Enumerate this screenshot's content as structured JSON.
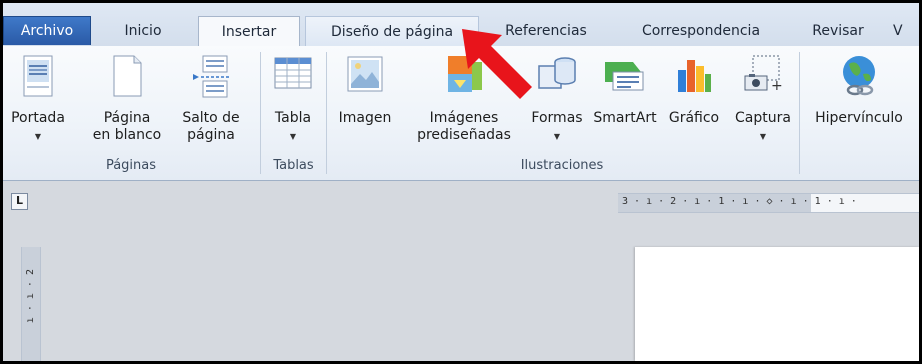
{
  "tabs": [
    {
      "label": "Archivo",
      "state": "file"
    },
    {
      "label": "Inicio",
      "state": "normal"
    },
    {
      "label": "Insertar",
      "state": "active"
    },
    {
      "label": "Diseño de página",
      "state": "hot"
    },
    {
      "label": "Referencias",
      "state": "normal"
    },
    {
      "label": "Correspondencia",
      "state": "normal"
    },
    {
      "label": "Revisar",
      "state": "normal"
    },
    {
      "label": "V",
      "state": "normal"
    }
  ],
  "ribbon": {
    "groups": {
      "paginas": "Páginas",
      "tablas": "Tablas",
      "ilustraciones": "Ilustraciones"
    },
    "buttons": {
      "portada": "Portada",
      "pagina_en_blanco_1": "Página",
      "pagina_en_blanco_2": "en blanco",
      "salto_de_pagina_1": "Salto de",
      "salto_de_pagina_2": "página",
      "tabla": "Tabla",
      "imagen": "Imagen",
      "imagenes_prediseñadas_1": "Imágenes",
      "imagenes_prediseñadas_2": "prediseñadas",
      "formas": "Formas",
      "smartart": "SmartArt",
      "grafico": "Gráfico",
      "captura": "Captura",
      "hipervinculo": "Hipervínculo"
    }
  },
  "ruler": {
    "corner": "L",
    "horizontal": "3 · ı · 2 · ı · 1 · ı · ◇ · ı · 1 · ı ·",
    "vertical": "ı · ı · 2"
  },
  "colors": {
    "file_tab": "#2a5aa6",
    "annotation_arrow": "#e8141b"
  }
}
